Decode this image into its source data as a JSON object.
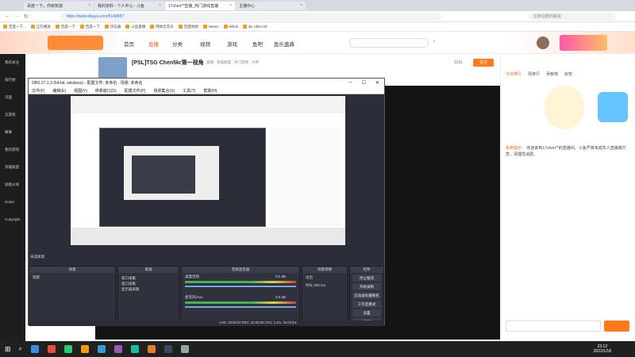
{
  "browser": {
    "tabs": [
      {
        "label": "百度一下，你就知道"
      },
      {
        "label": "我的资料 - 个人中心 - 斗鱼"
      },
      {
        "label": "17chen**直播_热门游戏直播"
      },
      {
        "label": "主播中心"
      }
    ],
    "url": "https://www.douyu.com/5140957",
    "search_placeholder": "拉菲伯爵的解说",
    "bookmarks": [
      "百度一下...",
      "正在播放",
      "百度一下",
      "百度一下",
      "浏览器",
      "斗鱼直播",
      "网易云音乐",
      "百度地图",
      "Steam",
      "bilibili",
      "4K Ultra HD"
    ]
  },
  "douyu": {
    "nav": [
      "首页",
      "直播",
      "分类",
      "视频",
      "游戏",
      "鱼吧",
      "鱼乐盛典"
    ],
    "sidebar": [
      "我的关注",
      "排行榜",
      "页面",
      "云游戏",
      "赛事",
      "我的游戏",
      "英雄联盟",
      "穿越火线",
      "Dota2",
      "Copyright"
    ],
    "room_title": "[PSL]TSG Chen5kr第一视角",
    "tags": [
      "直播",
      "英雄联盟",
      "热门游戏",
      "大神"
    ],
    "follow_btn": "关注",
    "followers": "1161",
    "right_tabs": [
      "今日排行",
      "周排行",
      "贡献榜",
      "房管"
    ],
    "notice_title": "系统提示",
    "notice_text": "欢迎来到17chen**的直播间。斗鱼严禁未成年人直播或打赏，请理性消费。"
  },
  "obs": {
    "title": "OBS 27.1.3 (64-bit, windows) - 配置文件: 未命名 - 场景: 未命名",
    "menu": [
      "文件(F)",
      "编辑(E)",
      "视图(V)",
      "停靠窗口(D)",
      "配置文件(P)",
      "场景集合(S)",
      "工具(T)",
      "帮助(H)"
    ],
    "scene_dock": "场景",
    "source_dock": "来源",
    "mixer_dock": "音频混音器",
    "transition_dock": "场景转换",
    "controls_dock": "控件",
    "sources": [
      "窗口采集",
      "窗口采集",
      "显示器采集"
    ],
    "mixer_tracks": [
      {
        "name": "桌面音频",
        "level": "0.0 dB"
      },
      {
        "name": "麦克风/Aux",
        "level": "0.0 dB"
      }
    ],
    "transition_type": "淡出",
    "transition_duration": "300 ms",
    "duration_label": "时长",
    "controls": [
      "停止推流",
      "开始录制",
      "启动虚拟摄像机",
      "工作室模式",
      "设置",
      "退出"
    ],
    "status": "LIVE: 00:00:00   REC: 00:00:00   CPU: 2.4%, 30.00 fps",
    "no_scene_label": "未选择源"
  },
  "taskbar": {
    "time": "23:12",
    "date": "2022/1/18"
  }
}
